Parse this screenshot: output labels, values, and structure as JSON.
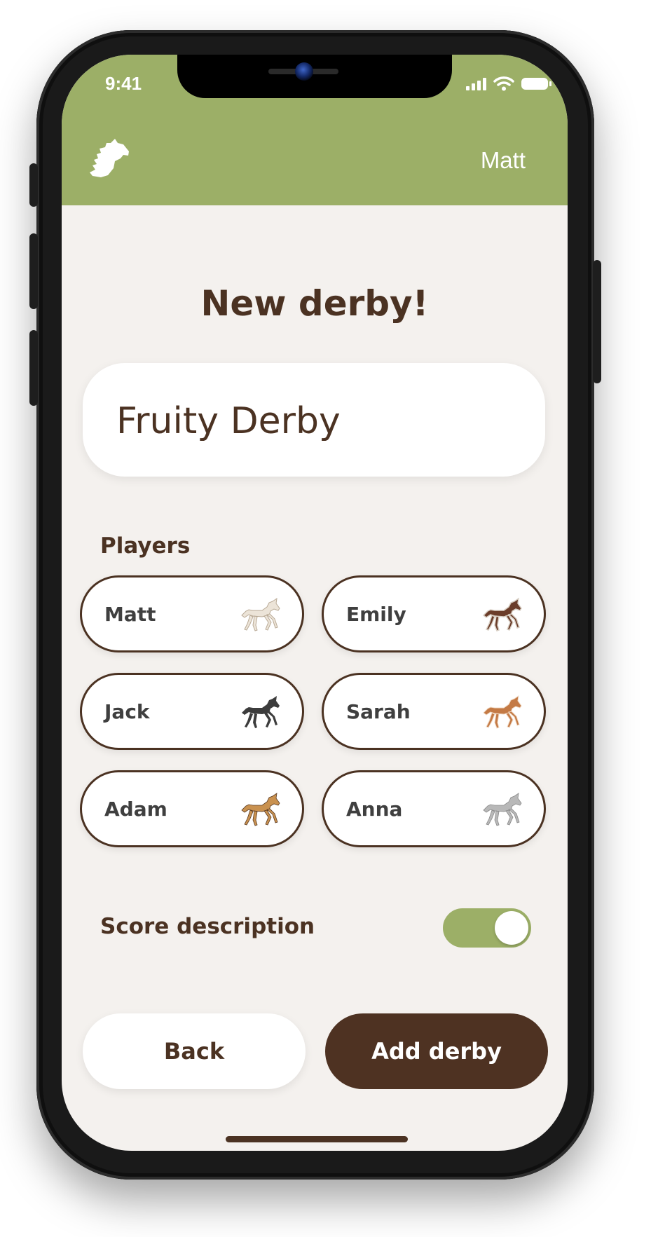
{
  "status_bar": {
    "time": "9:41"
  },
  "header": {
    "logo_icon": "horse-head-icon",
    "user_name": "Matt"
  },
  "page": {
    "title": "New derby!",
    "derby_name": {
      "value": "Fruity Derby",
      "placeholder": ""
    },
    "players_label": "Players",
    "players": [
      {
        "name": "Matt",
        "horse_color": "#ece4d8",
        "horse_icon": "white-horse-icon"
      },
      {
        "name": "Emily",
        "horse_color": "#6b3d2a",
        "horse_icon": "pinto-horse-icon"
      },
      {
        "name": "Jack",
        "horse_color": "#3c3c3c",
        "horse_icon": "black-horse-icon"
      },
      {
        "name": "Sarah",
        "horse_color": "#c47a45",
        "horse_icon": "chestnut-horse-icon"
      },
      {
        "name": "Adam",
        "horse_color": "#c9914f",
        "horse_icon": "palomino-horse-icon"
      },
      {
        "name": "Anna",
        "horse_color": "#b8b8b8",
        "horse_icon": "grey-horse-icon"
      }
    ],
    "score_description_label": "Score description",
    "score_description_enabled": true
  },
  "actions": {
    "back_label": "Back",
    "add_label": "Add derby"
  },
  "colors": {
    "accent_green": "#9caf67",
    "brown": "#4b3222",
    "background": "#f4f1ee"
  }
}
